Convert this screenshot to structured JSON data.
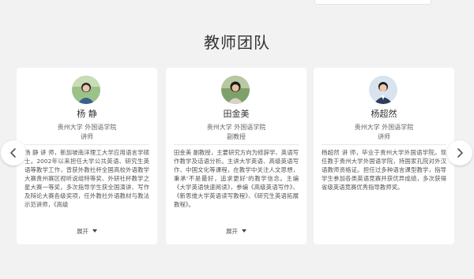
{
  "section": {
    "title": "教师团队"
  },
  "teachers": [
    {
      "name": "杨 静",
      "department": "贵州大学 外国语学院",
      "role": "讲师",
      "bio": "杨 静 讲 师，新加坡南洋理工大学应用语言学硕士。2002年以来担任大学公共英语、研究生英语等教学工作，曾获外教社杯全国高校外语教学大赛贵州赛区视听说组特等奖、外研社杯教学之星大赛一等奖，多次指导学生获全国演讲、写作及辩论大赛各级奖项，任外教社外语教材与教法示范讲师，《高级",
      "expand_label": "展开"
    },
    {
      "name": "田金美",
      "department": "贵州大学 外国语学院",
      "role": "副教授",
      "bio": "田金美 副教授，主要研究方向为修辞学、英语写作教学及话语分析。主讲大学英语、高级英语写作、中国文化等课程，在教学中关注人文思想，秉承'不是最好，追求更好'的教学信念。主编《大学英语快速阅读》，参编《高级英语写作》、《新思维大学英语读写教程》、《研究生英语拓展教程》。",
      "expand_label": "展开"
    },
    {
      "name": "杨超然",
      "department": "贵州大学 外国语学院",
      "role": "讲师",
      "bio": "杨超然 讲 师，毕业于贵州大学外国语学院。现任教于贵州大学外国语学院，持国家孔院对外汉语教师资格证。担任过多种语言课型教学，指导学生参加各类英语竞赛并获优异成绩，多次获得省级英语竞赛优秀指导教师奖。",
      "expand_label": ""
    }
  ],
  "icons": {
    "prev": "chevron-left-icon",
    "next": "chevron-right-icon",
    "expand": "caret-down-icon"
  },
  "colors": {
    "page_background": "#f2f2f2",
    "card_background": "#ffffff"
  }
}
